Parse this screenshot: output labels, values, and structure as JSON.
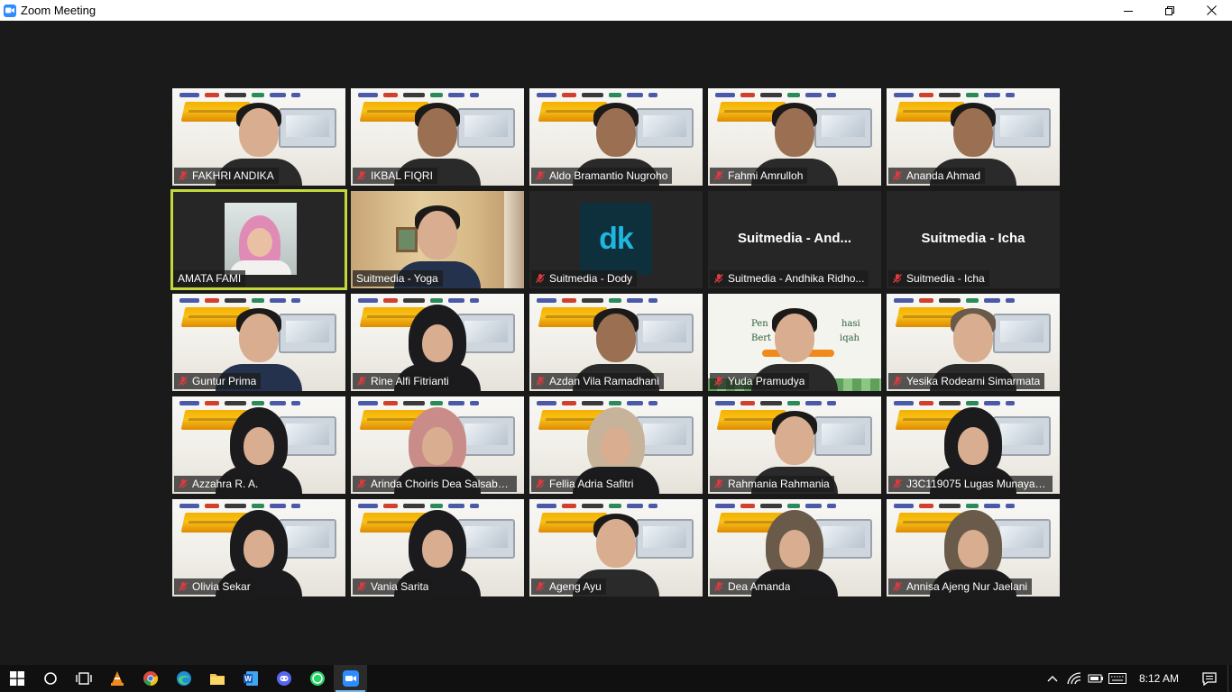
{
  "window": {
    "title": "Zoom Meeting",
    "icons": [
      "zoom-app-icon",
      "minimize-icon",
      "restore-icon",
      "close-icon"
    ]
  },
  "participants": [
    {
      "name": "FAKHRI ANDIKA",
      "muted": true,
      "video": true
    },
    {
      "name": "IKBAL FIQRI",
      "muted": true,
      "video": true
    },
    {
      "name": "Aldo Bramantio Nugroho",
      "muted": true,
      "video": true
    },
    {
      "name": "Fahmi Amrulloh",
      "muted": true,
      "video": true
    },
    {
      "name": "Ananda Ahmad",
      "muted": true,
      "video": true
    },
    {
      "name": "AMATA FAMI",
      "muted": false,
      "video": false,
      "active_speaker": true
    },
    {
      "name": "Suitmedia - Yoga",
      "muted": false,
      "video": true
    },
    {
      "name": "Suitmedia - Dody",
      "muted": true,
      "video": false,
      "avatar_text": "dk"
    },
    {
      "name": "Suitmedia - Andhika Ridho...",
      "muted": true,
      "video": false,
      "center_text": "Suitmedia - And..."
    },
    {
      "name": "Suitmedia - Icha",
      "muted": true,
      "video": false,
      "center_text": "Suitmedia - Icha"
    },
    {
      "name": "Guntur Prima",
      "muted": true,
      "video": true
    },
    {
      "name": "Rine Alfi Fitrianti",
      "muted": true,
      "video": true
    },
    {
      "name": "Azdan Vila Ramadhani",
      "muted": true,
      "video": true
    },
    {
      "name": "Yuda Pramudya",
      "muted": true,
      "video": true,
      "slide_text_1": "Pen",
      "slide_text_2": "Bert",
      "slide_text_3": "hasi",
      "slide_text_4": "iqah"
    },
    {
      "name": "Yesika Rodearni Simarmata",
      "muted": true,
      "video": true
    },
    {
      "name": "Azzahra R. A.",
      "muted": true,
      "video": true
    },
    {
      "name": "Arinda Choiris Dea Salsabe...",
      "muted": true,
      "video": true
    },
    {
      "name": "Fellia Adria Safitri",
      "muted": true,
      "video": true
    },
    {
      "name": "Rahmania Rahmania",
      "muted": true,
      "video": true
    },
    {
      "name": "J3C119075 Lugas Munayas...",
      "muted": true,
      "video": true
    },
    {
      "name": "Olivia Sekar",
      "muted": true,
      "video": true
    },
    {
      "name": "Vania Sarita",
      "muted": true,
      "video": true
    },
    {
      "name": "Ageng Ayu",
      "muted": true,
      "video": true
    },
    {
      "name": "Dea Amanda",
      "muted": true,
      "video": true
    },
    {
      "name": "Annisa Ajeng Nur Jaelani",
      "muted": true,
      "video": true
    }
  ],
  "colors": {
    "active_speaker_border": "#c4d83b",
    "muted_mic": "#e0393e",
    "zoom_blue": "#2d8cff"
  },
  "taskbar": {
    "items": [
      "start-icon",
      "search-icon",
      "task-view-icon",
      "vlc-icon",
      "chrome-icon",
      "edge-icon",
      "file-explorer-icon",
      "word-icon",
      "discord-icon",
      "whatsapp-icon",
      "zoom-icon"
    ],
    "clock": "8:12 AM",
    "tray_icons": [
      "chevron-up-icon",
      "wifi-icon",
      "battery-icon",
      "keyboard-icon",
      "notification-icon"
    ]
  }
}
